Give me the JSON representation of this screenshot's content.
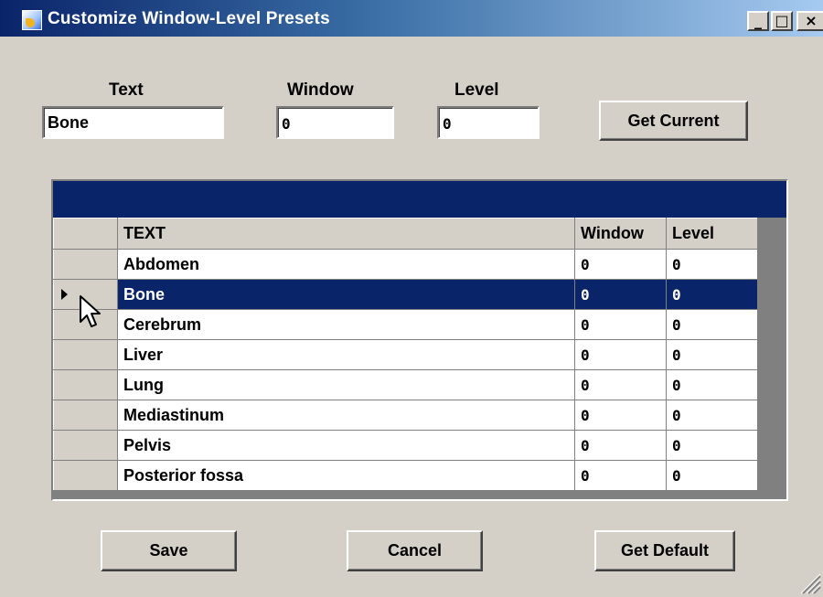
{
  "window": {
    "title": "Customize Window-Level Presets",
    "controls": {
      "minimize": "_",
      "maximize": "□",
      "close": "×"
    }
  },
  "form": {
    "text_label": "Text",
    "window_label": "Window",
    "level_label": "Level",
    "text_value": "Bone",
    "window_value": "0",
    "level_value": "0",
    "get_current_label": "Get Current"
  },
  "grid": {
    "columns": [
      "TEXT",
      "Window",
      "Level"
    ],
    "selected_index": 1,
    "rows": [
      {
        "text": "Abdomen",
        "window": "0",
        "level": "0"
      },
      {
        "text": "Bone",
        "window": "0",
        "level": "0"
      },
      {
        "text": "Cerebrum",
        "window": "0",
        "level": "0"
      },
      {
        "text": "Liver",
        "window": "0",
        "level": "0"
      },
      {
        "text": "Lung",
        "window": "0",
        "level": "0"
      },
      {
        "text": "Mediastinum",
        "window": "0",
        "level": "0"
      },
      {
        "text": "Pelvis",
        "window": "0",
        "level": "0"
      },
      {
        "text": "Posterior fossa",
        "window": "0",
        "level": "0"
      }
    ]
  },
  "footer": {
    "save_label": "Save",
    "cancel_label": "Cancel",
    "get_default_label": "Get Default"
  },
  "colors": {
    "face": "#d4d0c8",
    "title_start": "#0a246a",
    "title_end": "#a6caf0",
    "selection": "#0a246a"
  },
  "icons": [
    "app-icon",
    "minimize-icon",
    "maximize-icon",
    "close-icon",
    "row-pointer-icon",
    "mouse-cursor-icon",
    "resize-grip-icon"
  ]
}
